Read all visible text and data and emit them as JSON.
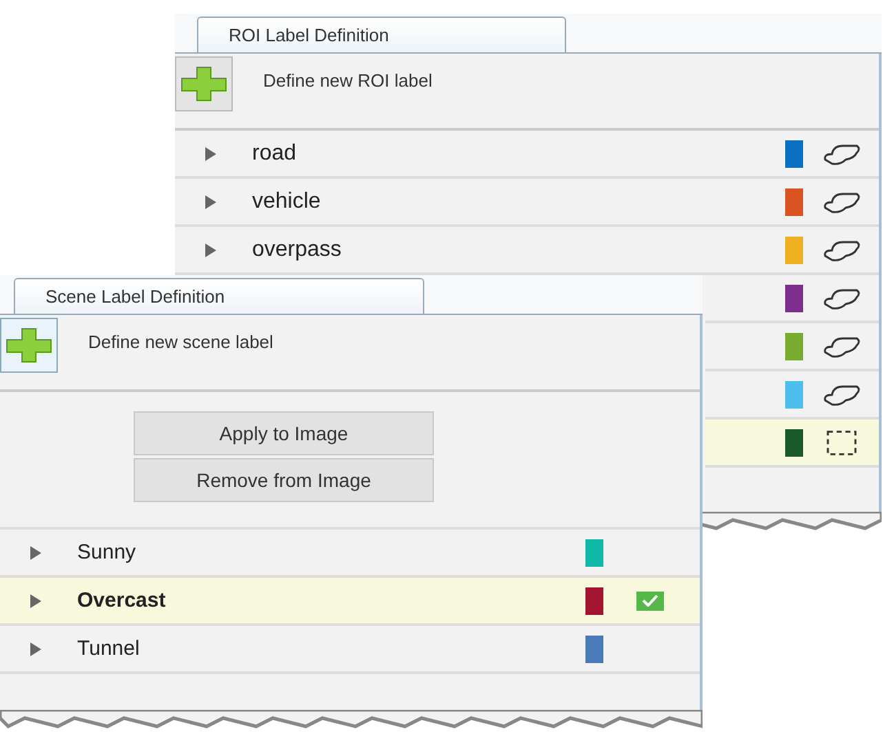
{
  "roi_panel": {
    "tab": "ROI Label Definition",
    "add_label": "Define new ROI label",
    "labels": [
      {
        "name": "road",
        "color": "#0a70c0",
        "kind": "polygon",
        "selected": false
      },
      {
        "name": "vehicle",
        "color": "#d95420",
        "kind": "polygon",
        "selected": false
      },
      {
        "name": "overpass",
        "color": "#edb020",
        "kind": "polygon",
        "selected": false
      },
      {
        "color": "#7e2f8e",
        "kind": "polygon",
        "selected": false
      },
      {
        "color": "#77ac30",
        "kind": "polygon",
        "selected": false
      },
      {
        "color": "#4dbeee",
        "kind": "polygon",
        "selected": false
      },
      {
        "color": "#1a5a2a",
        "kind": "rectangle",
        "selected": true
      }
    ]
  },
  "scene_panel": {
    "tab": "Scene Label Definition",
    "add_label": "Define new scene label",
    "buttons": [
      "Apply to Image",
      "Remove from Image"
    ],
    "labels": [
      {
        "name": "Sunny",
        "color": "#10b8a8",
        "selected": false,
        "checked": false
      },
      {
        "name": "Overcast",
        "color": "#a2142f",
        "selected": true,
        "checked": true
      },
      {
        "name": "Tunnel",
        "color": "#4a7ab8",
        "selected": false,
        "checked": false
      }
    ]
  }
}
